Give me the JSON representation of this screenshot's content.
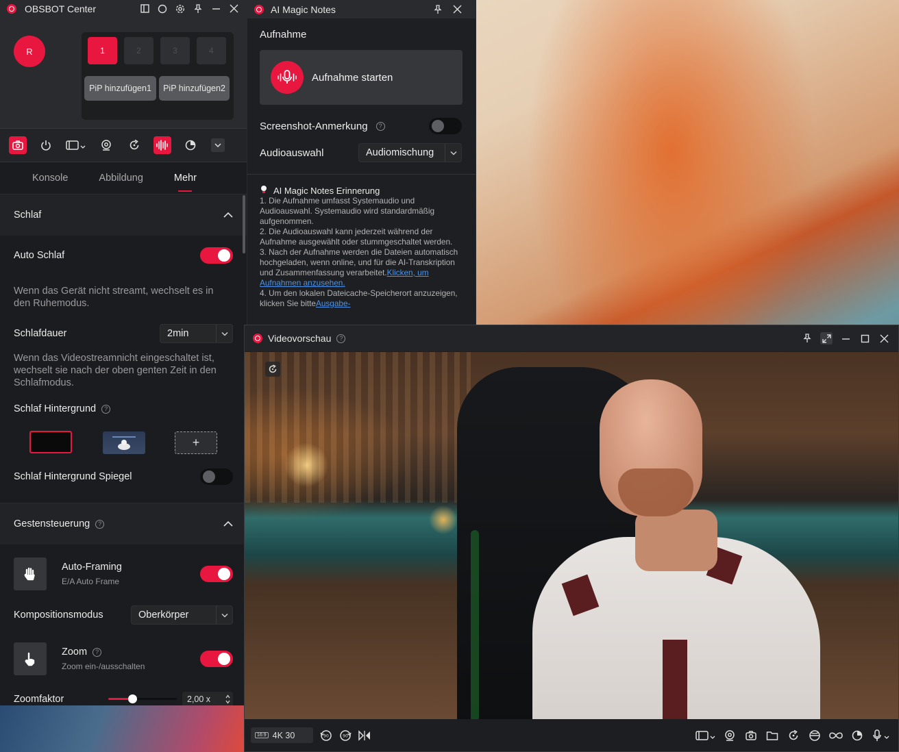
{
  "obsbot": {
    "title": "OBSBOT Center",
    "avatar_initial": "R",
    "slots": [
      "1",
      "2",
      "3",
      "4"
    ],
    "pip_buttons": [
      "PiP hinzufügen1",
      "PiP hinzufügen2"
    ],
    "tabs": [
      "Konsole",
      "Abbildung",
      "Mehr"
    ],
    "active_tab": "Mehr",
    "sleep": {
      "section_title": "Schlaf",
      "auto_sleep_label": "Auto Schlaf",
      "auto_sleep_on": true,
      "auto_sleep_desc": "Wenn das Gerät nicht streamt, wechselt es in den Ruhemodus.",
      "duration_label": "Schlafdauer",
      "duration_value": "2min",
      "duration_desc": "Wenn das Videostreamnicht eingeschaltet ist, wechselt sie nach der oben genten Zeit in den Schlafmodus.",
      "background_label": "Schlaf Hintergrund",
      "thumb_add": "+",
      "mirror_label": "Schlaf Hintergrund Spiegel",
      "mirror_on": false
    },
    "gesture": {
      "section_title": "Gestensteuerung",
      "autoframing_label": "Auto-Framing",
      "autoframing_sub": "E/A Auto Frame",
      "autoframing_on": true,
      "composition_label": "Kompositionsmodus",
      "composition_value": "Oberkörper",
      "zoom_label": "Zoom",
      "zoom_sub": "Zoom ein-/ausschalten",
      "zoom_on": true,
      "zoomfactor_label": "Zoomfaktor",
      "zoomfactor_value": "2,00 x",
      "zoomfactor_level": 0.35
    }
  },
  "magic_notes": {
    "title": "AI Magic Notes",
    "section_title": "Aufnahme",
    "record_label": "Aufnahme starten",
    "screenshot_label": "Screenshot-Anmerkung",
    "screenshot_on": false,
    "audio_label": "Audioauswahl",
    "audio_value": "Audiomischung",
    "reminder_title": "AI Magic Notes Erinnerung",
    "reminder_1": "1. Die Aufnahme umfasst Systemaudio und Audioauswahl. Systemaudio wird standardmäßig aufgenommen.",
    "reminder_2": "2. Die Audioauswahl kann jederzeit während der Aufnahme ausgewählt oder stummgeschaltet werden.",
    "reminder_3_pre": "3. Nach der Aufnahme werden die Dateien automatisch hochgeladen, wenn online, und für die AI-Transkription und Zusammenfassung verarbeitet.",
    "reminder_3_link": "Klicken, um Aufnahmen anzusehen.",
    "reminder_4_pre": "4. Um den lokalen Dateicache-Speicherort anzuzeigen, klicken Sie bitte",
    "reminder_4_link": "Ausgabe-"
  },
  "video": {
    "title": "Videovorschau",
    "aspect_badge": "16:9",
    "resolution": "4K 30"
  },
  "colors": {
    "accent": "#e8173f",
    "link": "#4d94e6"
  }
}
